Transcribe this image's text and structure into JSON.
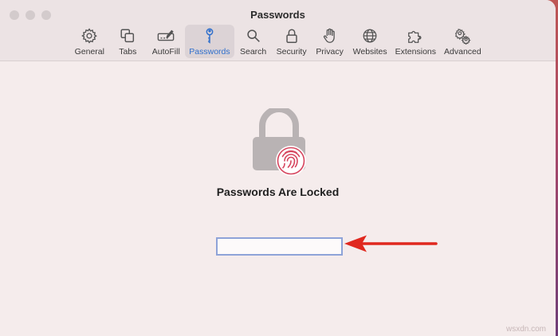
{
  "window": {
    "title": "Passwords"
  },
  "toolbar": {
    "items": [
      {
        "label": "General",
        "icon": "gear-icon"
      },
      {
        "label": "Tabs",
        "icon": "tabs-icon"
      },
      {
        "label": "AutoFill",
        "icon": "autofill-icon"
      },
      {
        "label": "Passwords",
        "icon": "key-icon",
        "active": true
      },
      {
        "label": "Search",
        "icon": "search-icon"
      },
      {
        "label": "Security",
        "icon": "lock-icon"
      },
      {
        "label": "Privacy",
        "icon": "hand-icon"
      },
      {
        "label": "Websites",
        "icon": "globe-icon"
      },
      {
        "label": "Extensions",
        "icon": "puzzle-icon"
      },
      {
        "label": "Advanced",
        "icon": "gears-icon"
      }
    ]
  },
  "main": {
    "heading": "Passwords Are Locked",
    "password_field": {
      "value": "",
      "placeholder": ""
    }
  },
  "annotation": {
    "arrow_color": "#e0281f"
  },
  "watermark": "wsxdn.com",
  "colors": {
    "accent": "#2f6fcc",
    "field_border": "#8ea3d8",
    "fingerprint": "#d6455e"
  }
}
